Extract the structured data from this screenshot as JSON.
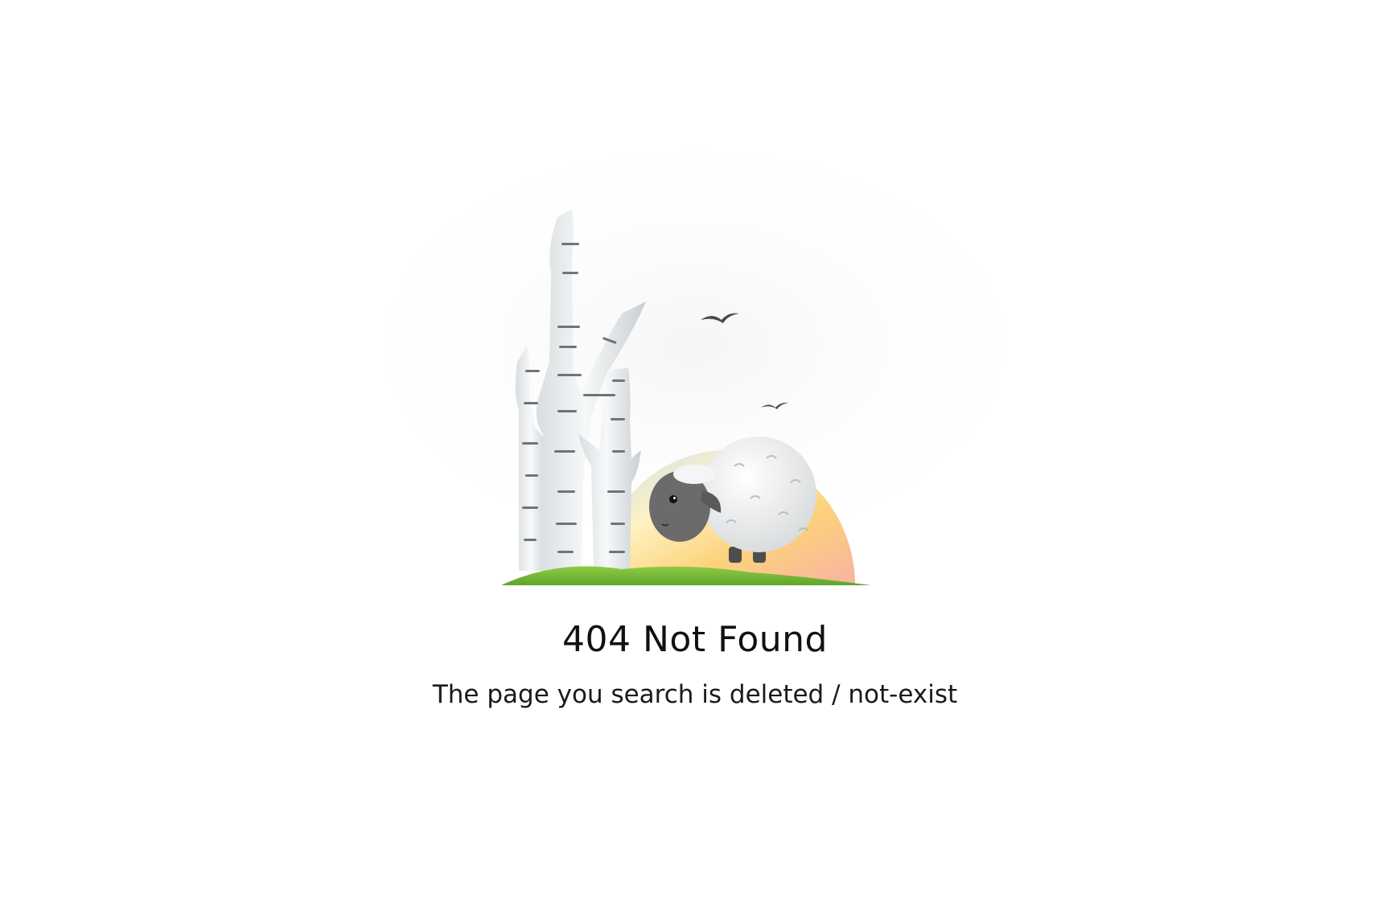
{
  "error": {
    "title": "404 Not Found",
    "message": "The page you search is deleted / not-exist"
  },
  "illustration": {
    "subject": "sheep-birch-trees-sunset",
    "colors": {
      "sun_top": "#cfe3f5",
      "sun_mid": "#fde08a",
      "sun_bottom": "#f7b9a6",
      "grass": "#7cbf3a",
      "bark": "#eef1f2",
      "bark_stripe": "#6f7478",
      "sheep_wool": "#f2f3f4",
      "sheep_face": "#6b6b6b",
      "bird": "#4a4a4a"
    }
  }
}
